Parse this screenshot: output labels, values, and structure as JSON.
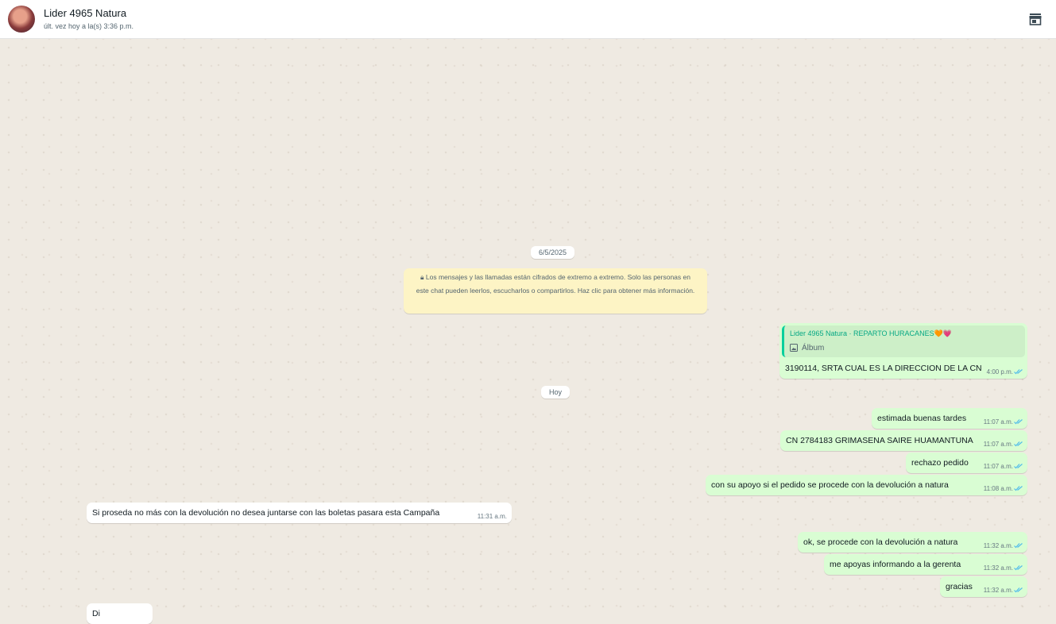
{
  "header": {
    "name": "Lider 4965 Natura",
    "status": "últ. vez hoy a la(s) 3:36 p.m.",
    "store_icon": "storefront-icon"
  },
  "chat": {
    "date1": "6/5/2025",
    "encryption_notice": "Los mensajes y las llamadas están cifrados de extremo a extremo. Solo las personas en este chat pueden leerlos, escucharlos o compartirlos. Haz clic para obtener más información.",
    "date2": "Hoy",
    "quoted": {
      "author": "Lider 4965 Natura · REPARTO HURACANES🧡💗",
      "album": "Álbum"
    },
    "messages": [
      {
        "text": "3190114, SRTA CUAL ES LA DIRECCION DE LA CN",
        "time": "4:00 p.m."
      },
      {
        "text": "estimada buenas tardes",
        "time": "11:07 a.m."
      },
      {
        "text": "CN 2784183 GRIMASENA SAIRE HUAMANTUNA",
        "time": "11:07 a.m."
      },
      {
        "text": "rechazo pedido",
        "time": "11:07 a.m."
      },
      {
        "text": "con su apoyo si el pedido se procede con la devolución a natura",
        "time": "11:08 a.m."
      },
      {
        "text": "Si proseda no más con la devolución no desea juntarse con las boletas pasara esta Campaña",
        "time": "11:31 a.m."
      },
      {
        "text": "ok, se procede con la devolución a natura",
        "time": "11:32 a.m."
      },
      {
        "text": "me apoyas informando a la gerenta",
        "time": "11:32 a.m."
      },
      {
        "text": "gracias",
        "time": "11:32 a.m."
      },
      {
        "text": "Di",
        "time": ""
      }
    ]
  },
  "colors": {
    "outgoing_bubble": "#d9fdd3",
    "incoming_bubble": "#ffffff",
    "read_ticks": "#53bdeb",
    "chat_background": "#efeae2"
  }
}
